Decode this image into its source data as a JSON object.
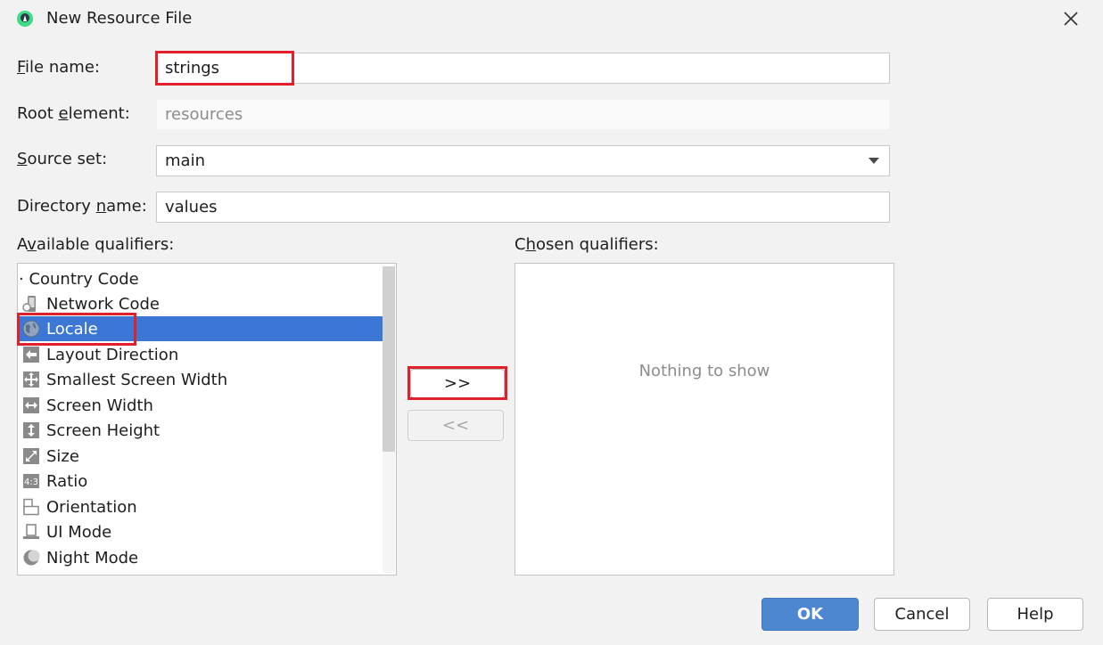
{
  "window": {
    "title": "New Resource File",
    "app_icon": "android-studio-icon",
    "close_icon": "close-icon"
  },
  "form": {
    "file_name": {
      "label_mnemonic": "F",
      "label_rest": "ile name:",
      "value": "strings"
    },
    "root_element": {
      "label_pre": "Root ",
      "label_mnemonic": "e",
      "label_rest": "lement:",
      "placeholder": "resources"
    },
    "source_set": {
      "label_mnemonic": "S",
      "label_rest": "ource set:",
      "value": "main"
    },
    "directory_name": {
      "label_pre": "Directory ",
      "label_mnemonic": "n",
      "label_rest": "ame:",
      "value": "values"
    }
  },
  "available": {
    "label_pre": "A",
    "label_mnemonic": "v",
    "label_rest": "ailable qualifiers:",
    "items": [
      {
        "label": "· Country Code",
        "icon": "none"
      },
      {
        "label": "Network Code",
        "icon": "network-code-icon"
      },
      {
        "label": "Locale",
        "icon": "globe-icon",
        "selected": true
      },
      {
        "label": "Layout Direction",
        "icon": "arrow-left-icon"
      },
      {
        "label": "Smallest Screen Width",
        "icon": "expand-arrows-icon"
      },
      {
        "label": "Screen Width",
        "icon": "horizontal-arrows-icon"
      },
      {
        "label": "Screen Height",
        "icon": "vertical-arrows-icon"
      },
      {
        "label": "Size",
        "icon": "diagonal-resize-icon"
      },
      {
        "label": "Ratio",
        "icon": "ratio-icon"
      },
      {
        "label": "Orientation",
        "icon": "orientation-icon"
      },
      {
        "label": "UI Mode",
        "icon": "ui-mode-icon"
      },
      {
        "label": "Night Mode",
        "icon": "moon-icon"
      }
    ]
  },
  "chosen": {
    "label_pre": "C",
    "label_mnemonic": "h",
    "label_rest": "osen qualifiers:",
    "empty_text": "Nothing to show"
  },
  "buttons": {
    "add": ">>",
    "remove": "<<",
    "ok": "OK",
    "cancel": "Cancel",
    "help": "Help"
  },
  "colors": {
    "selection": "#3d77d6",
    "primary_button": "#4d87cf",
    "annotation_red": "#e0202a"
  }
}
